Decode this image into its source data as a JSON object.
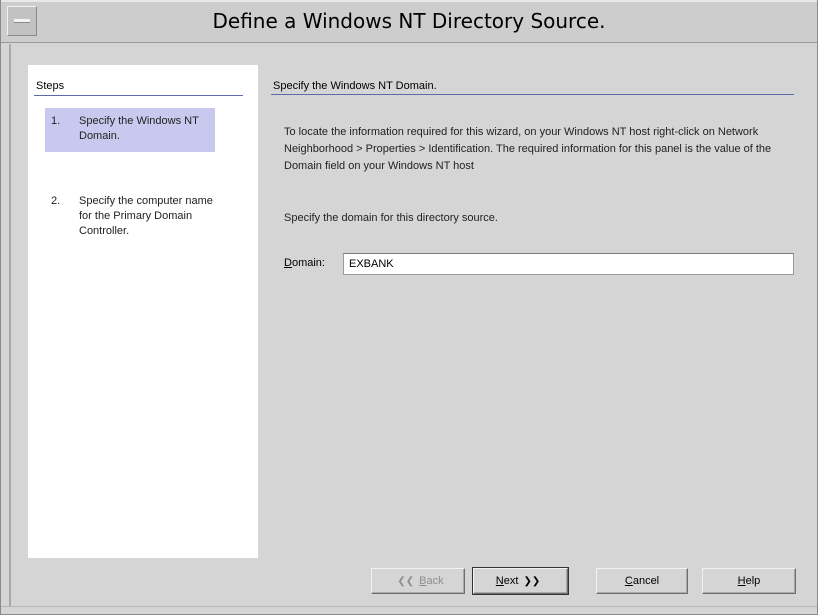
{
  "window": {
    "title": "Define a Windows NT Directory Source."
  },
  "steps": {
    "header": "Steps",
    "items": [
      {
        "number": "1.",
        "label": "Specify the Windows NT Domain.",
        "active": true
      },
      {
        "number": "2.",
        "label": "Specify the computer name for the Primary Domain Controller.",
        "active": false
      }
    ]
  },
  "content": {
    "header": "Specify the Windows NT Domain.",
    "description": "To locate the information required for this wizard, on your Windows NT host right-click on Network Neighborhood > Properties > Identification. The required information for this panel is the value of the Domain field on your Windows NT host",
    "prompt": "Specify the domain for this directory source.",
    "domain_label_mnemonic": "D",
    "domain_label_rest": "omain:",
    "domain_value": "EXBANK"
  },
  "buttons": {
    "back": {
      "mnemonic": "B",
      "rest": "ack"
    },
    "next": {
      "mnemonic": "N",
      "rest": "ext"
    },
    "cancel": {
      "mnemonic": "C",
      "rest": "ancel"
    },
    "help": {
      "mnemonic": "H",
      "rest": "elp"
    }
  },
  "icons": {
    "back": "double-chevron-left-icon",
    "next": "double-chevron-right-icon",
    "system_menu": "window-menu-icon"
  }
}
